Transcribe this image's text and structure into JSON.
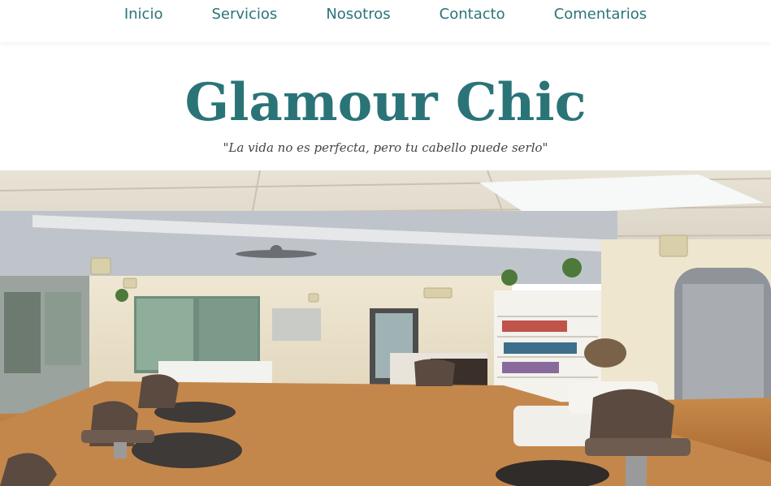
{
  "nav": {
    "items": [
      {
        "label": "Inicio"
      },
      {
        "label": "Servicios"
      },
      {
        "label": "Nosotros"
      },
      {
        "label": "Contacto"
      },
      {
        "label": "Comentarios"
      }
    ]
  },
  "brand": {
    "name": "Glamour Chic",
    "tagline": "\"La vida no es perfecta, pero tu cabello puede serlo\""
  },
  "colors": {
    "brand_teal": "#2a7478",
    "nav_text": "#2a7477"
  },
  "hero": {
    "photo_subject": "salon-interior-photo"
  }
}
